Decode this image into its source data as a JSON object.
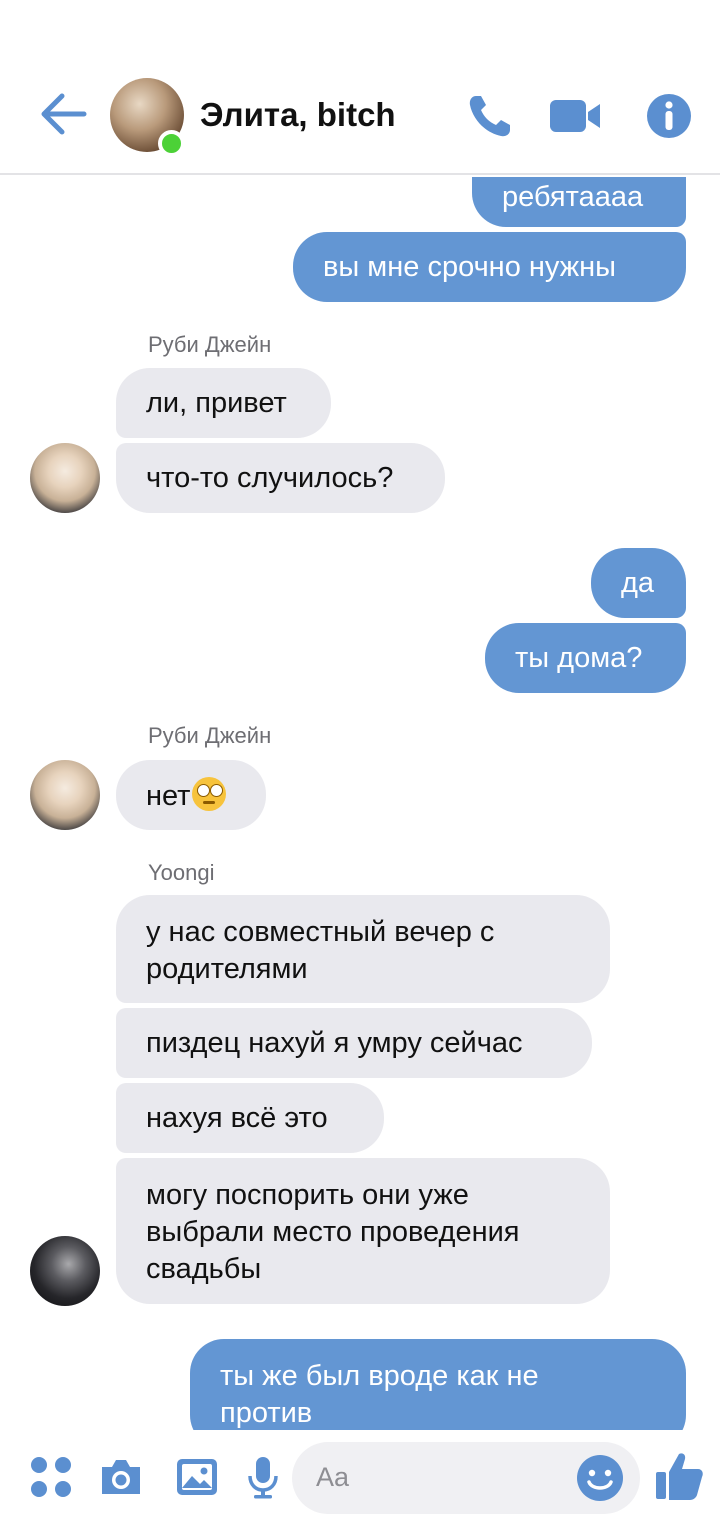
{
  "header": {
    "title": "Элита, bitch"
  },
  "messages": {
    "m1": "ребятаааа",
    "m2": "вы мне срочно нужны",
    "s1": "Руби Джейн",
    "m3": "ли, привет",
    "m4": "что-то случилось?",
    "m5": "да",
    "m6": "ты дома?",
    "s2": "Руби Джейн",
    "m7": "нет",
    "s3": "Yoongi",
    "m8a": "у нас совместный вечер с",
    "m8b": "родителями",
    "m9": "пиздец нахуй я умру сейчас",
    "m10": "нахуя всё это",
    "m11a": "могу поспорить они уже",
    "m11b": "выбрали место проведения",
    "m11c": "свадьбы",
    "m12a": "ты же был вроде как не",
    "m12b": "против"
  },
  "composer": {
    "placeholder": "Aa"
  },
  "colors": {
    "accent": "#6396d3",
    "incoming_bubble": "#e9e9ee",
    "online": "#4cd137"
  }
}
